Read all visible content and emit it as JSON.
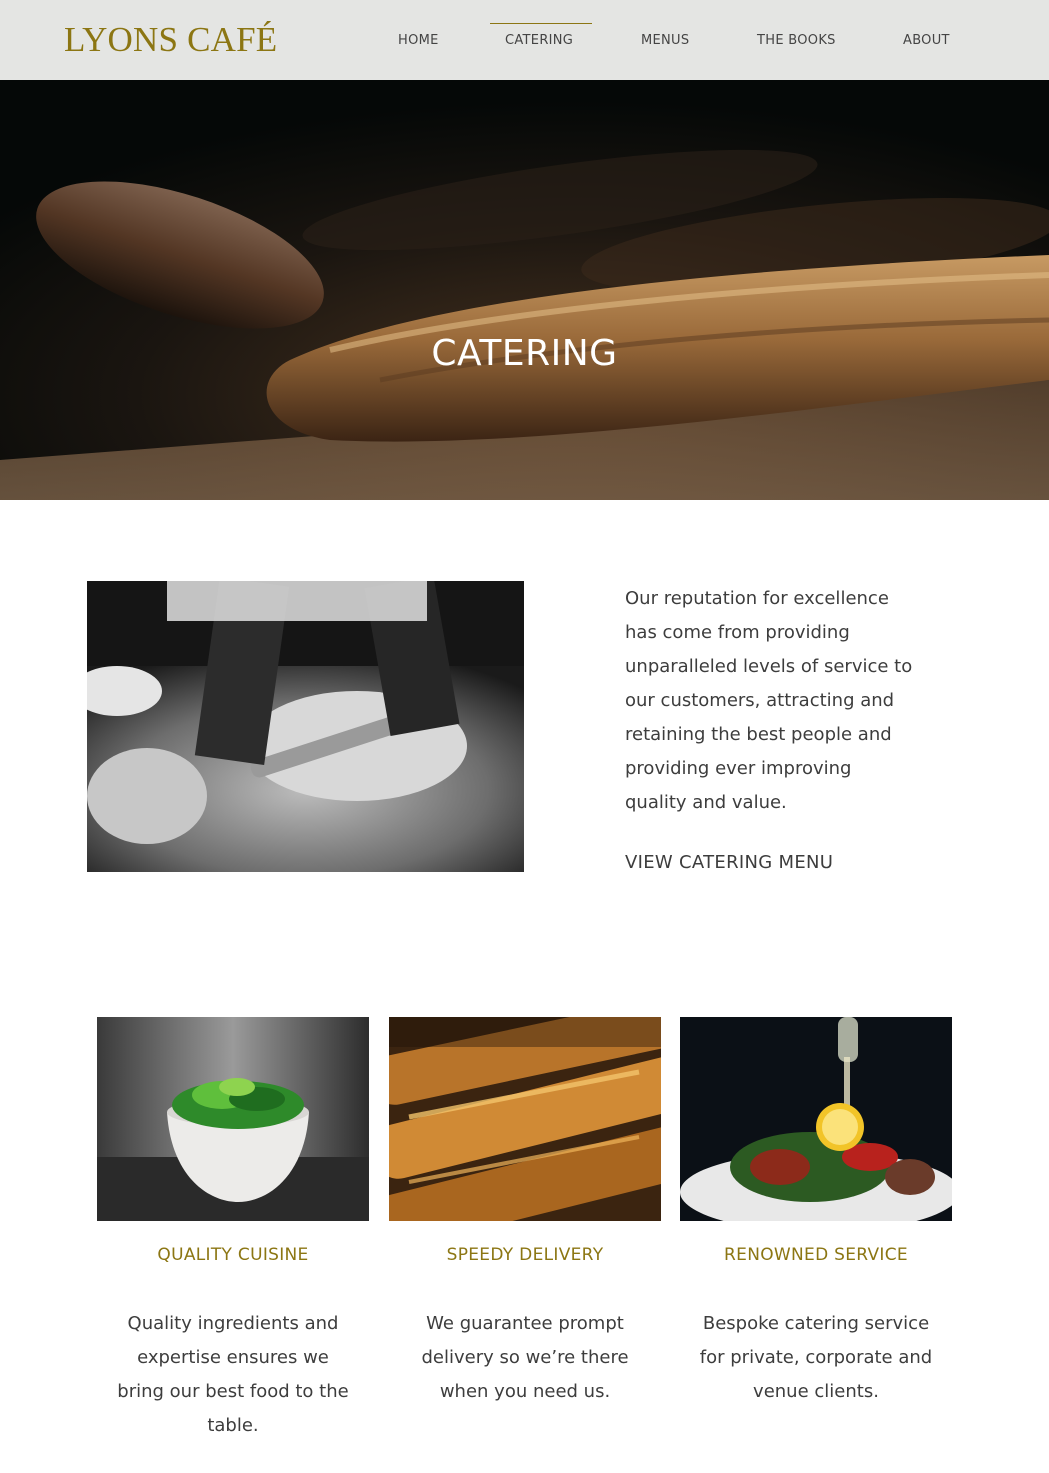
{
  "header": {
    "logo": "LYONS CAFÉ",
    "nav": [
      "HOME",
      "CATERING",
      "MENUS",
      "THE BOOKS",
      "ABOUT"
    ],
    "active": "CATERING",
    "accent_color": "#8c7613"
  },
  "hero": {
    "title": "CATERING"
  },
  "intro": {
    "text": "Our reputation for excellence has come from providing unparalleled levels of service to our customers, attracting and retaining the best people and providing ever improving quality and value.",
    "cta": "VIEW CATERING MENU"
  },
  "features": [
    {
      "title": "QUALITY CUISINE",
      "text": "Quality ingredients and expertise ensures we bring our best food to the table."
    },
    {
      "title": "SPEEDY DELIVERY",
      "text": "We guarantee prompt delivery so we’re there when you need us."
    },
    {
      "title": "RENOWNED SERVICE",
      "text": "Bespoke catering service for private, corporate and venue clients."
    }
  ]
}
